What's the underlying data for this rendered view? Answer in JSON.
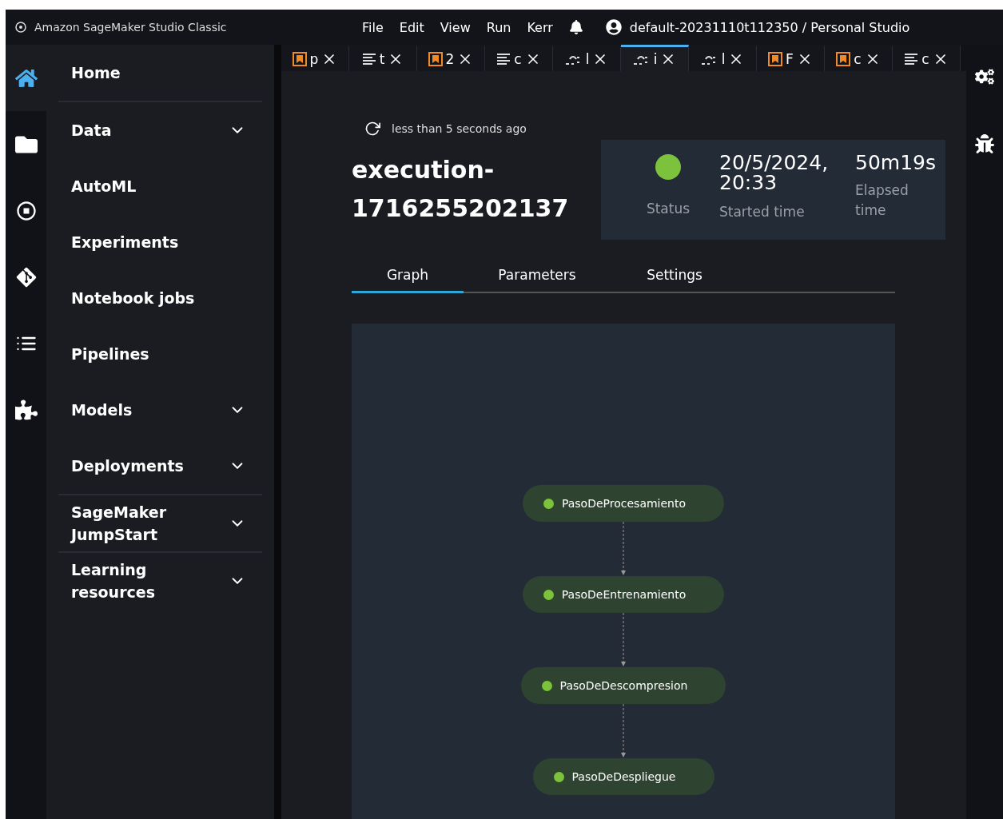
{
  "top_bar": {
    "app_title": "Amazon SageMaker Studio Classic",
    "menu": [
      "File",
      "Edit",
      "View",
      "Run",
      "Kerr"
    ],
    "user": "default-20231110t112350 / Personal Studio"
  },
  "rail": [
    {
      "kind": "home",
      "selected": true
    },
    {
      "kind": "folder",
      "selected": false
    },
    {
      "kind": "stop",
      "selected": false
    },
    {
      "kind": "git",
      "selected": false
    },
    {
      "kind": "list",
      "selected": false
    },
    {
      "kind": "puzzle",
      "selected": false
    }
  ],
  "sidebar": {
    "items": [
      {
        "label": "Home",
        "expandable": false,
        "divider_after": true
      },
      {
        "label": "Data",
        "expandable": true,
        "divider_after": false
      },
      {
        "label": "AutoML",
        "expandable": false,
        "divider_after": false
      },
      {
        "label": "Experiments",
        "expandable": false,
        "divider_after": false
      },
      {
        "label": "Notebook jobs",
        "expandable": false,
        "divider_after": false
      },
      {
        "label": "Pipelines",
        "expandable": false,
        "divider_after": false
      },
      {
        "label": "Models",
        "expandable": true,
        "divider_after": false
      },
      {
        "label": "Deployments",
        "expandable": true,
        "divider_after": true
      },
      {
        "label": "SageMaker JumpStart",
        "expandable": true,
        "divider_after": true
      },
      {
        "label": "Learning resources",
        "expandable": true,
        "divider_after": false
      }
    ]
  },
  "doc_tabs": [
    {
      "kind": "notebook",
      "label": "p",
      "selected": false
    },
    {
      "kind": "text",
      "label": "t",
      "selected": false
    },
    {
      "kind": "notebook",
      "label": "2",
      "selected": false
    },
    {
      "kind": "text",
      "label": "c",
      "selected": false
    },
    {
      "kind": "pipeline",
      "label": "l",
      "selected": false
    },
    {
      "kind": "pipeline",
      "label": "i",
      "selected": true
    },
    {
      "kind": "pipeline",
      "label": "l",
      "selected": false
    },
    {
      "kind": "notebook",
      "label": "F",
      "selected": false
    },
    {
      "kind": "notebook",
      "label": "c",
      "selected": false
    },
    {
      "kind": "text",
      "label": "c",
      "selected": false
    }
  ],
  "execution": {
    "refreshed": "less than 5 seconds ago",
    "title": "execution-1716255202137",
    "summary": {
      "status_label": "Status",
      "started": "20/5/2024, 20:33",
      "started_label": "Started time",
      "elapsed": "50m19s",
      "elapsed_label": "Elapsed time"
    },
    "tabs": [
      {
        "label": "Graph",
        "selected": true
      },
      {
        "label": "Parameters",
        "selected": false
      },
      {
        "label": "Settings",
        "selected": false
      }
    ],
    "graph": {
      "steps": [
        {
          "name": "PasoDeProcesamiento",
          "color": "#7dc23c"
        },
        {
          "name": "PasoDeEntrenamiento",
          "color": "#7dc23c"
        },
        {
          "name": "PasoDeDescompresion",
          "color": "#7dc23c"
        },
        {
          "name": "PasoDeDespliegue",
          "color": "#7dc23c"
        }
      ]
    }
  }
}
